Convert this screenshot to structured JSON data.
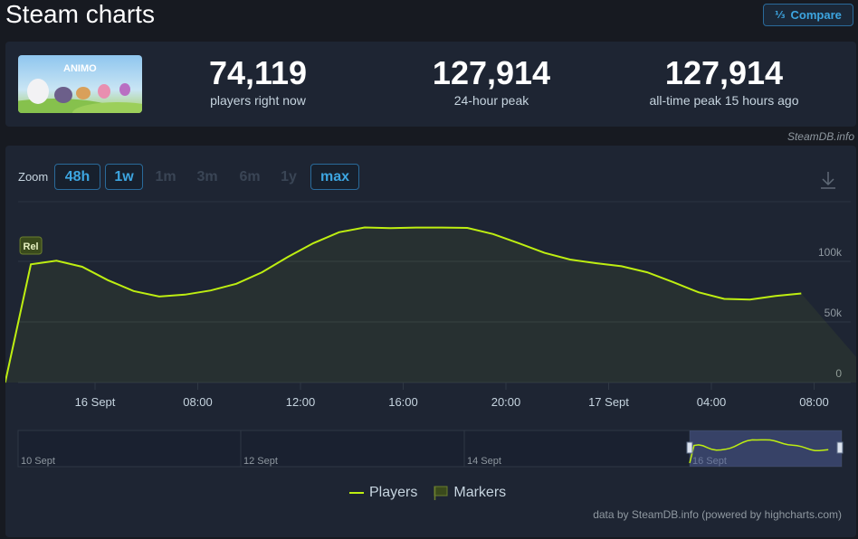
{
  "header": {
    "title": "Steam charts",
    "compare_label": "Compare",
    "compare_icon": "sort-numeric-icon"
  },
  "game": {
    "logo_text": "ANIMO"
  },
  "stats": [
    {
      "value": "74,119",
      "label": "players right now"
    },
    {
      "value": "127,914",
      "label": "24-hour peak"
    },
    {
      "value": "127,914",
      "label": "all-time peak 15 hours ago"
    }
  ],
  "credit": "SteamDB.info",
  "zoom": {
    "label": "Zoom",
    "buttons": [
      {
        "label": "48h",
        "active": true
      },
      {
        "label": "1w",
        "active": true
      },
      {
        "label": "1m",
        "active": false
      },
      {
        "label": "3m",
        "active": false
      },
      {
        "label": "6m",
        "active": false
      },
      {
        "label": "1y",
        "active": false
      },
      {
        "label": "max",
        "active": true
      }
    ]
  },
  "legend": {
    "players": "Players",
    "markers": "Markers"
  },
  "footer": "data by SteamDB.info (powered by highcharts.com)",
  "colors": {
    "series": "#beee11",
    "accent": "#3da5e0",
    "marker_bg": "#3a4a1c"
  },
  "chart_data": {
    "type": "line",
    "title": "",
    "series": [
      {
        "name": "Players",
        "x_hours": [
          -3.5,
          -2.5,
          -1.5,
          -0.5,
          0.5,
          1.5,
          2.5,
          3.5,
          4.5,
          5.5,
          6.5,
          7.5,
          8.5,
          9.5,
          10.5,
          11.5,
          12.5,
          13.5,
          14.5,
          15.5,
          16.5,
          17.5,
          18.5,
          19.5,
          20.5,
          21.5,
          22.5,
          23.5,
          24.5,
          25.5,
          26.5,
          27.5,
          28.5,
          29.5,
          30.5
        ],
        "values": [
          0,
          97500,
          100500,
          95500,
          84500,
          75500,
          71000,
          72500,
          76000,
          81500,
          91000,
          103500,
          115000,
          124000,
          128000,
          127500,
          127900,
          127900,
          127600,
          122500,
          115000,
          107000,
          101500,
          98500,
          96000,
          91000,
          83000,
          74500,
          69000,
          68500,
          71500,
          73500
        ]
      }
    ],
    "x_tick_labels": [
      "16 Sept",
      "08:00",
      "12:00",
      "16:00",
      "20:00",
      "17 Sept",
      "04:00",
      "08:00"
    ],
    "y_tick_labels": [
      "0",
      "50k",
      "100k"
    ],
    "ylim": [
      0,
      150000
    ],
    "markers": [
      {
        "label": "Rel",
        "x_hour": -2.5
      }
    ],
    "navigator_labels": [
      "10 Sept",
      "12 Sept",
      "14 Sept",
      "16 Sept"
    ],
    "grid": true,
    "legend_position": "bottom"
  }
}
